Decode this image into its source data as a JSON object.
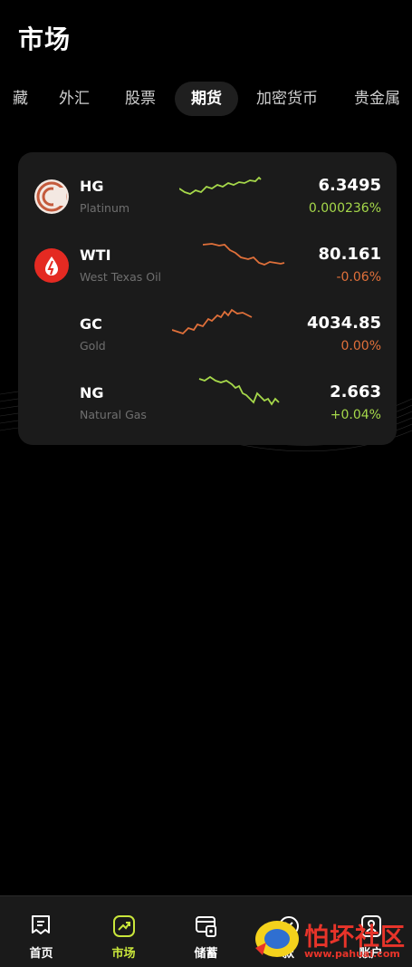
{
  "header": {
    "title": "市场"
  },
  "tabs": [
    "藏",
    "外汇",
    "股票",
    "期货",
    "加密货币",
    "贵金属"
  ],
  "active_tab": "期货",
  "colors": {
    "up": "#a6d84a",
    "down": "#e0703a",
    "card": "#1b1b1b",
    "accent": "#c9e63b"
  },
  "futures": [
    {
      "symbol": "HG",
      "name": "Platinum",
      "price": "6.3495",
      "change": "0.000236%",
      "trend": "up",
      "logo": "copper-logo-icon"
    },
    {
      "symbol": "WTI",
      "name": "West Texas Oil",
      "price": "80.161",
      "change": "-0.06%",
      "trend": "down",
      "logo": "oil-drop-logo-icon"
    },
    {
      "symbol": "GC",
      "name": "Gold",
      "price": "4034.85",
      "change": "0.00%",
      "trend": "down",
      "logo": ""
    },
    {
      "symbol": "NG",
      "name": "Natural Gas",
      "price": "2.663",
      "change": "+0.04%",
      "trend": "up",
      "logo": ""
    }
  ],
  "nav": [
    {
      "label": "首页",
      "icon": "home-icon",
      "active": false
    },
    {
      "label": "市场",
      "icon": "market-icon",
      "active": true
    },
    {
      "label": "储蓄",
      "icon": "savings-icon",
      "active": false
    },
    {
      "label": "款",
      "icon": "loan-icon",
      "active": false
    },
    {
      "label": "账户",
      "icon": "account-icon",
      "active": false
    }
  ],
  "watermark": {
    "text": "怕坏社区",
    "url": "www.pahuai.com"
  }
}
